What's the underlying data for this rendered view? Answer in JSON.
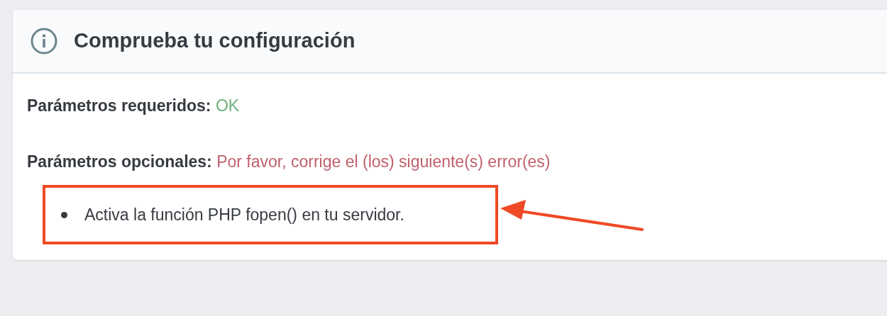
{
  "card": {
    "title": "Comprueba tu configuración",
    "checks": [
      {
        "label": "Parámetros requeridos:",
        "message": "OK",
        "ok": true
      },
      {
        "label": "Parámetros opcionales:",
        "message": "Por favor, corrige el (los) siguiente(s) error(es)",
        "ok": false
      }
    ],
    "errors": [
      "Activa la función PHP fopen() en tu servidor."
    ]
  }
}
